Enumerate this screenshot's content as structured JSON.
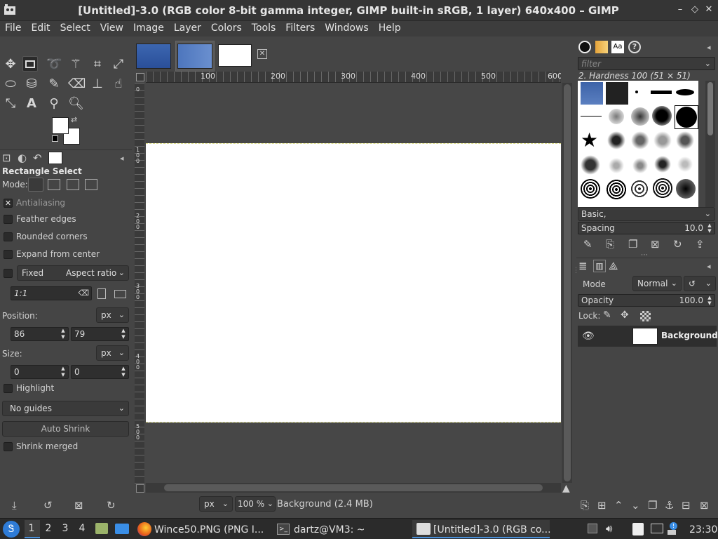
{
  "window": {
    "title": "[Untitled]-3.0 (RGB color 8-bit gamma integer, GIMP built-in sRGB, 1 layer) 640x400 – GIMP",
    "controls": [
      "–",
      "◇",
      "✕"
    ]
  },
  "menubar": [
    "File",
    "Edit",
    "Select",
    "View",
    "Image",
    "Layer",
    "Colors",
    "Tools",
    "Filters",
    "Windows",
    "Help"
  ],
  "tool_options": {
    "heading": "Rectangle Select",
    "mode_label": "Mode:",
    "antialiasing": "Antialiasing",
    "feather_edges": "Feather edges",
    "rounded_corners": "Rounded corners",
    "expand_from_center": "Expand from center",
    "fixed_label": "Fixed",
    "fixed_value": "Aspect ratio",
    "ratio_value": "1:1",
    "position_label": "Position:",
    "position_unit": "px",
    "position_x": "86",
    "position_y": "79",
    "size_label": "Size:",
    "size_unit": "px",
    "size_w": "0",
    "size_h": "0",
    "highlight": "Highlight",
    "guides": "No guides",
    "auto_shrink": "Auto Shrink",
    "shrink_merged": "Shrink merged"
  },
  "ruler": {
    "top_ticks": [
      "100",
      "200",
      "300",
      "400",
      "500",
      "600"
    ],
    "left_ticks": [
      "0",
      "100",
      "200",
      "300",
      "400",
      "500"
    ]
  },
  "statusbar": {
    "unit": "px",
    "zoom": "100 %",
    "info": "Background (2.4 MB)"
  },
  "brushes": {
    "filter_placeholder": "filter",
    "current": "2. Hardness 100 (51 × 51)",
    "tag": "Basic,",
    "spacing_label": "Spacing",
    "spacing_value": "10.0"
  },
  "layers": {
    "mode_label": "Mode",
    "mode_value": "Normal",
    "opacity_label": "Opacity",
    "opacity_value": "100.0",
    "lock_label": "Lock:",
    "layer_name": "Background"
  },
  "taskbar": {
    "workspaces": [
      "1",
      "2",
      "3",
      "4"
    ],
    "tasks": [
      "Wince50.PNG (PNG I...",
      "dartz@VM3: ~",
      "[Untitled]-3.0 (RGB co..."
    ],
    "clock": "23:30"
  },
  "colors": {
    "accent_active_task": "#4a90d9",
    "selection_marching": "#e0e08a"
  }
}
